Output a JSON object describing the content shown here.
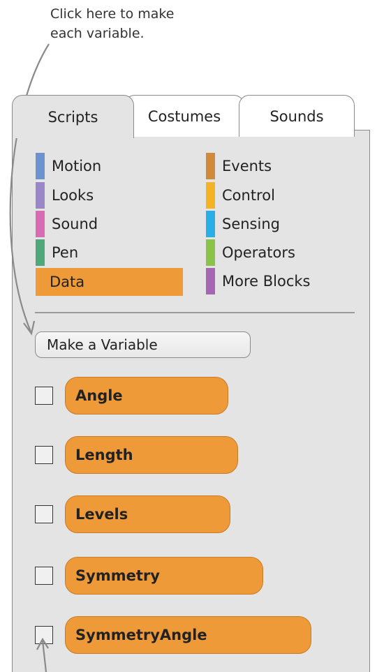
{
  "annotation": {
    "text": "Click here to make\neach variable."
  },
  "tabs": [
    {
      "label": "Scripts",
      "selected": true
    },
    {
      "label": "Costumes",
      "selected": false
    },
    {
      "label": "Sounds",
      "selected": false
    }
  ],
  "categories": [
    {
      "label": "Motion",
      "color": "#6c93d0"
    },
    {
      "label": "Looks",
      "color": "#9a87c8"
    },
    {
      "label": "Sound",
      "color": "#d76cb3"
    },
    {
      "label": "Pen",
      "color": "#4fa87a"
    },
    {
      "label": "Data",
      "color": "#ef9a39",
      "selected": true
    },
    {
      "label": "Events",
      "color": "#cf8a3c"
    },
    {
      "label": "Control",
      "color": "#f4b324"
    },
    {
      "label": "Sensing",
      "color": "#29aee6"
    },
    {
      "label": "Operators",
      "color": "#8bc34a"
    },
    {
      "label": "More Blocks",
      "color": "#a566b4"
    }
  ],
  "make_variable_button": "Make a Variable",
  "variables": [
    {
      "name": "Angle",
      "checked": false
    },
    {
      "name": "Length",
      "checked": false
    },
    {
      "name": "Levels",
      "checked": false
    },
    {
      "name": "Symmetry",
      "checked": false
    },
    {
      "name": "SymmetryAngle",
      "checked": false
    }
  ],
  "colors": {
    "panel_bg": "#e4e4e4",
    "variable_block": "#ef9a39",
    "data_selected": "#ef9a39"
  }
}
